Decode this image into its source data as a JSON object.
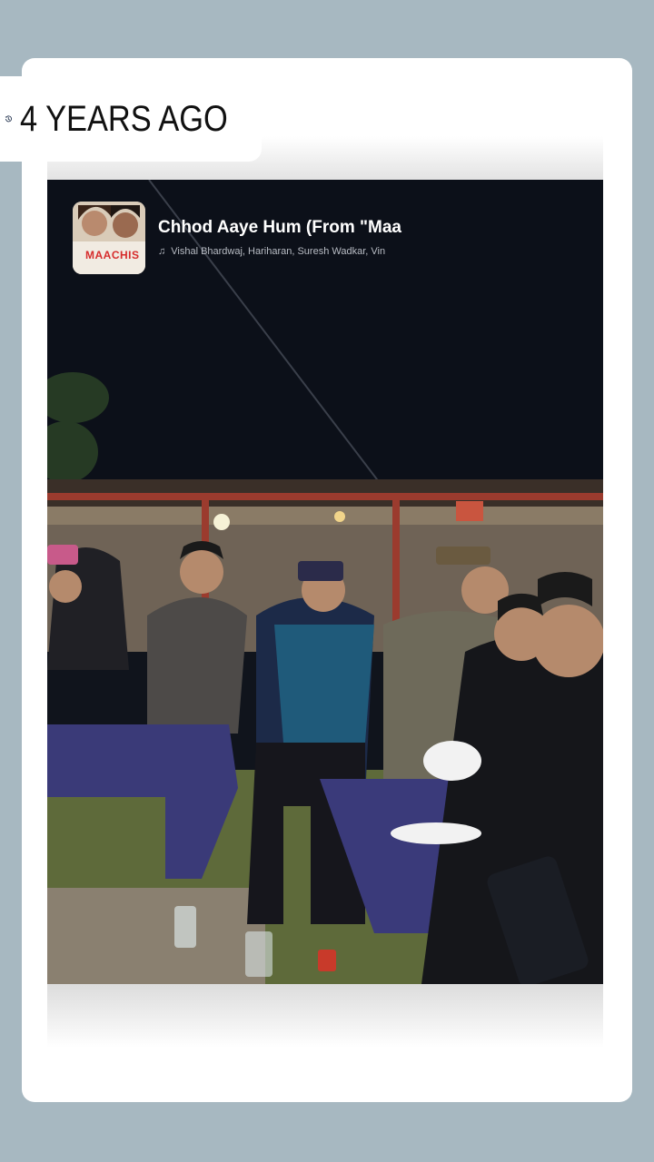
{
  "memory": {
    "label": "4 YEARS AGO",
    "icon": "history-clock-icon"
  },
  "music": {
    "track_title": "Chhod Aaye Hum (From \"Maa",
    "artists": "Vishal Bhardwaj, Hariharan, Suresh Wadkar, Vin",
    "album_art_text": "MAACHIS",
    "note_icon": "music-note-icon"
  },
  "colors": {
    "background": "#a7b8c1",
    "card": "#ffffff",
    "night_sky": "#10141c",
    "text_dark": "#111111"
  }
}
